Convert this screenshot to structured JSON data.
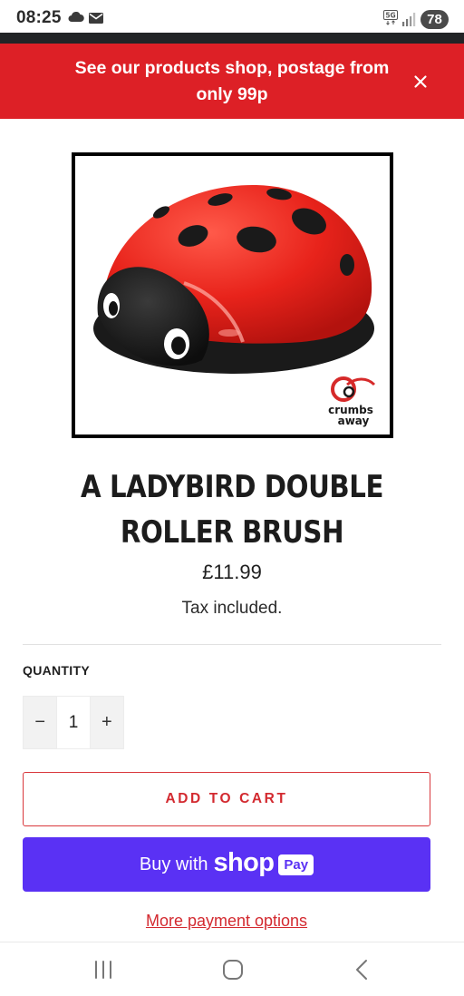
{
  "status_bar": {
    "time": "08:25",
    "battery": "78",
    "network": "5G",
    "icons": [
      "cloud-icon",
      "mail-icon",
      "5g-icon",
      "signal-icon"
    ]
  },
  "announcement": {
    "text": "See our products shop, postage from only 99p",
    "close_icon": "close-icon",
    "background": "#dd2026"
  },
  "product": {
    "image_brand_line1": "crumbs",
    "image_brand_line2": "away",
    "title": "A LADYBIRD DOUBLE ROLLER BRUSH",
    "price": "£11.99",
    "tax_note": "Tax included."
  },
  "quantity": {
    "label": "QUANTITY",
    "value": "1",
    "decrement": "−",
    "increment": "+"
  },
  "actions": {
    "add_to_cart": "ADD TO CART",
    "shop_pay_prefix": "Buy with",
    "shop_pay_brand": "shop",
    "shop_pay_badge": "Pay",
    "more_options": "More payment options",
    "accent_color": "#d32a30",
    "shop_pay_color": "#5a31f4"
  },
  "nav_bar": {
    "icons": [
      "recent-apps-icon",
      "home-icon",
      "back-icon"
    ]
  }
}
